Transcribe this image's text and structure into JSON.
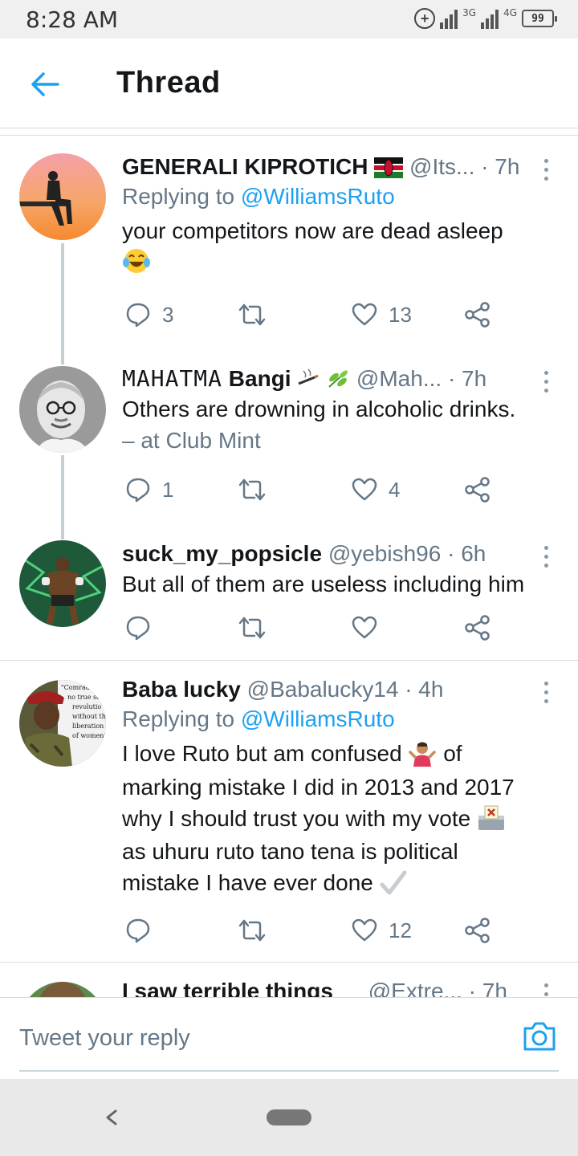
{
  "status_bar": {
    "time": "8:28 AM",
    "network1": "3G",
    "network2": "4G",
    "battery": "99"
  },
  "header": {
    "title": "Thread"
  },
  "tweets": [
    {
      "name": "GENERALI KIPROTICH",
      "handle": "@Its...",
      "time": "· 7h",
      "replying_prefix": "Replying to ",
      "replying_to": "@WilliamsRuto",
      "text": "your competitors now are dead asleep",
      "replies": "3",
      "retweets": "",
      "likes": "13"
    },
    {
      "name_stylized": "MAHATMA",
      "name": "Bangi",
      "handle": "@Mah...",
      "time": "· 7h",
      "text": "Others are drowning in alcoholic drinks.",
      "location": "– at Club Mint",
      "replies": "1",
      "retweets": "",
      "likes": "4"
    },
    {
      "name": "suck_my_popsicle",
      "handle": "@yebish96",
      "time": "· 6h",
      "text": "But all of them are useless including him",
      "replies": "",
      "retweets": "",
      "likes": ""
    },
    {
      "name": "Baba lucky",
      "handle": "@Babalucky14",
      "time": "· 4h",
      "replying_prefix": "Replying to ",
      "replying_to": "@WilliamsRuto",
      "text_line1": "I love Ruto but am confused",
      "text_line1b": "of",
      "text_line2": "marking mistake I did in 2013 and 2017",
      "text_line3": "why I should trust you with my vote",
      "text_line4": "as uhuru ruto tano tena is political",
      "text_line5": "mistake I have ever done",
      "avatar_text": "Comrades, no true social revolution without the liberation of women",
      "replies": "",
      "retweets": "",
      "likes": "12"
    },
    {
      "name": "I saw terrible things",
      "handle": "@Extre...",
      "time": "· 7h"
    }
  ],
  "reply_bar": {
    "placeholder": "Tweet your reply"
  },
  "icons": {
    "accent": "#1da1f2",
    "muted": "#657786"
  }
}
